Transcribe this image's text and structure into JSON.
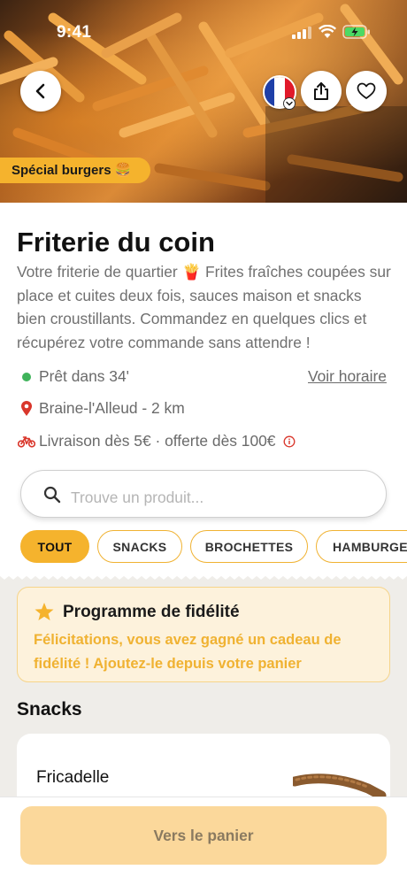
{
  "status_bar": {
    "time": "9:41"
  },
  "hero": {
    "promo_badge": "Spécial burgers",
    "promo_emoji": "🍔",
    "flag_colors": [
      "#1e3fa8",
      "#ffffff",
      "#e1192a"
    ]
  },
  "restaurant": {
    "name": "Friterie du coin",
    "description": "Votre friterie de quartier 🍟 Frites fraîches coupées sur place et cuites deux fois, sauces maison et snacks bien croustillants. Commandez en quelques clics et récupérez votre commande sans attendre !",
    "ready_time": "Prêt dans 34'",
    "schedule_link": "Voir horaire",
    "location": "Braine-l'Alleud - 2 km",
    "delivery": "Livraison dès 5€ · offerte dès 100€"
  },
  "search": {
    "placeholder": "Trouve un produit..."
  },
  "tabs": [
    {
      "label": "TOUT",
      "active": true
    },
    {
      "label": "SNACKS",
      "active": false
    },
    {
      "label": "BROCHETTES",
      "active": false
    },
    {
      "label": "HAMBURGERS",
      "active": false
    }
  ],
  "loyalty": {
    "title": "Programme de fidélité",
    "message": "Félicitations, vous avez gagné un cadeau de fidélité ! Ajoutez-le depuis votre panier"
  },
  "section": {
    "title": "Snacks"
  },
  "products": [
    {
      "name": "Fricadelle"
    }
  ],
  "cart": {
    "button_label": "Vers le panier"
  },
  "colors": {
    "accent": "#f5b32d",
    "accent_light": "#fbd89b",
    "status_green": "#3fb35a",
    "location_red": "#d9362b",
    "background_section": "#efede9"
  }
}
